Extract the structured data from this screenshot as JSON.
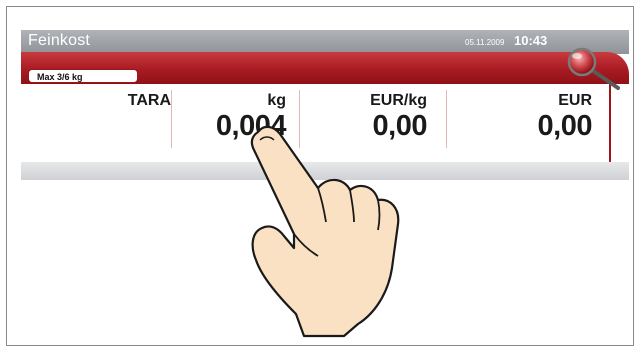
{
  "window": {
    "title": "Feinkost"
  },
  "status": {
    "date": "05.11.2009",
    "time": "10:43"
  },
  "badge": {
    "max_capacity": "Max 3/6 kg"
  },
  "fields": {
    "tara": {
      "label": "TARA",
      "value": ""
    },
    "weight": {
      "label": "kg",
      "value": "0,004"
    },
    "unit_price": {
      "label": "EUR/kg",
      "value": "0,00"
    },
    "total": {
      "label": "EUR",
      "value": "0,00"
    }
  },
  "icons": {
    "zoom": "magnifier-icon",
    "pointer": "pointing-hand"
  },
  "colors": {
    "accent_red": "#a81b22",
    "titlebar_gray": "#9da0a4",
    "text": "#1a1a1a"
  }
}
